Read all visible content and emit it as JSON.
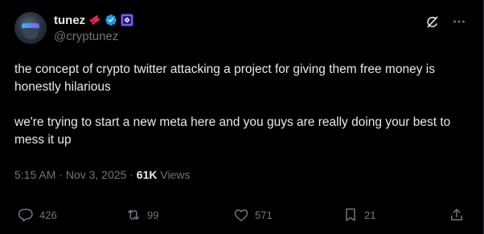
{
  "author": {
    "display_name": "tunez",
    "handle": "@cryptunez"
  },
  "icons": {
    "ticket_badge": "ticket-icon",
    "verified_badge": "verified-badge-icon",
    "affiliate_badge": "affiliate-badge-icon",
    "grok": "grok-icon",
    "more": "more-icon"
  },
  "tweet": {
    "paragraph_1": "the concept of crypto twitter attacking a project for giving them free money is honestly hilarious",
    "paragraph_2": "we're trying to start a new meta here and you guys are really doing your best to mess it up"
  },
  "meta": {
    "time": "5:15 AM",
    "separator": " · ",
    "date": "Nov 3, 2025",
    "separator2": " · ",
    "views_count": "61K",
    "views_label": " Views"
  },
  "actions": {
    "replies": "426",
    "reposts": "99",
    "likes": "571",
    "bookmarks": "21"
  },
  "colors": {
    "background": "#000000",
    "text": "#e7e9ea",
    "muted": "#71767b",
    "verified": "#1d9bf0",
    "ticket": "#e0245e",
    "affiliate": "#7856ff"
  }
}
